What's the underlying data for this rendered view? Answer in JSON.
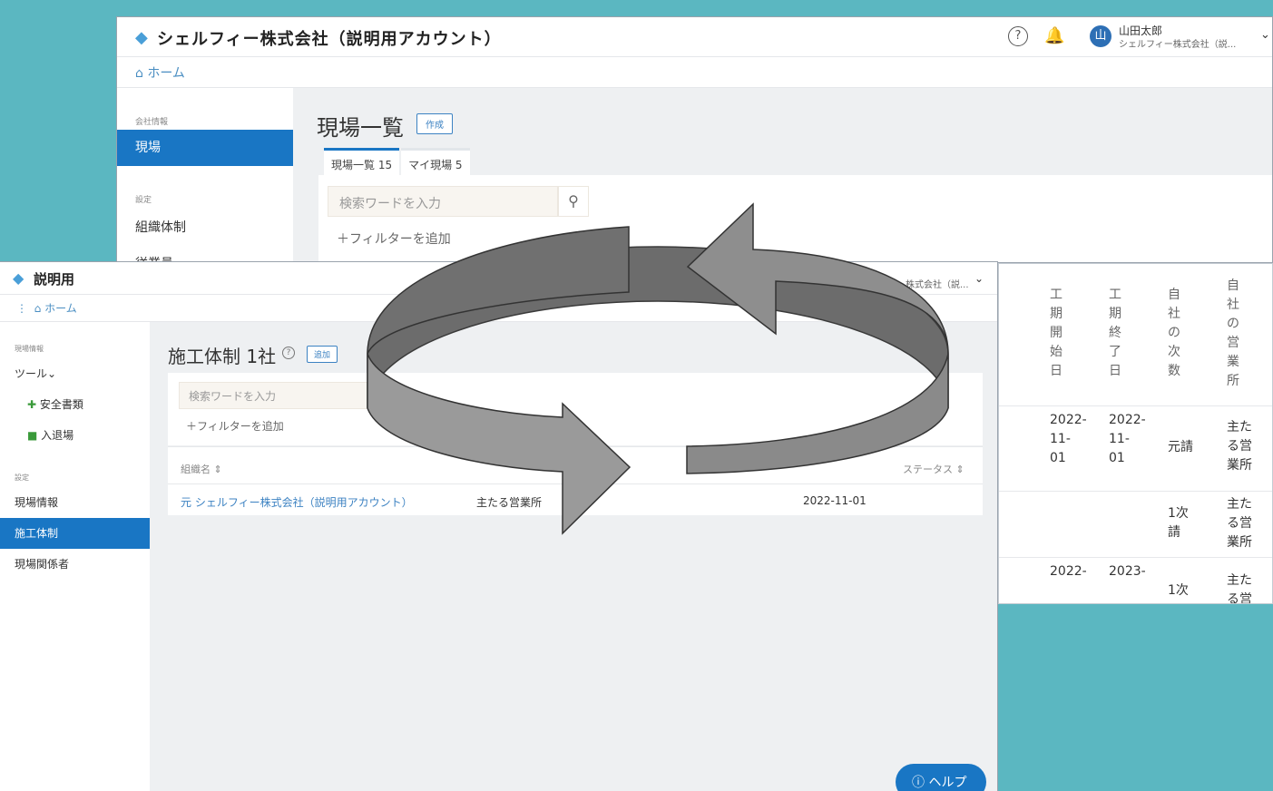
{
  "back_window": {
    "company_name": "シェルフィー株式会社（説明用アカウント）",
    "user": {
      "avatar": "山",
      "name": "山田太郎",
      "company": "シェルフィー株式会社（説..."
    },
    "breadcrumb": "ホーム",
    "sidebar": {
      "section_company": "会社情報",
      "item_sites": "現場",
      "section_settings": "設定",
      "item_org": "組織体制",
      "item_employees": "従業員"
    },
    "page_title": "現場一覧",
    "create_button": "作成",
    "tabs": [
      {
        "label": "現場一覧 15"
      },
      {
        "label": "マイ現場 5"
      }
    ],
    "search_placeholder": "検索ワードを入力",
    "filter_label": "＋フィルターを追加",
    "table_fragment": {
      "headers": [
        "工期開始日",
        "工期終了日",
        "自社の次数",
        "自社の営業所"
      ],
      "rows": [
        {
          "start": "2022-11-01",
          "end": "2022-11-01",
          "tier": "元請",
          "office": "主たる営業所"
        },
        {
          "start": "",
          "end": "",
          "tier": "1次請",
          "office": "主たる営業所"
        },
        {
          "start": "2022-",
          "end": "2023-",
          "tier": "1次",
          "office": "主たる営"
        }
      ]
    }
  },
  "front_window": {
    "company_name": "説明用",
    "user_company": "株式会社（説...",
    "breadcrumb": "ホーム",
    "sidebar": {
      "section_site": "現場情報",
      "tools_label": "ツール",
      "tool_safety": "安全書類",
      "tool_entry": "入退場",
      "section_settings": "設定",
      "item_site_info": "現場情報",
      "item_structure": "施工体制",
      "item_people": "現場関係者"
    },
    "page_title": "施工体制 1社",
    "add_button": "追加",
    "search_placeholder": "検索ワードを入力",
    "filter_label": "＋フィルターを追加",
    "table": {
      "headers": [
        "組織名",
        "",
        "",
        "ステータス"
      ],
      "row": {
        "tier": "元",
        "org": "シェルフィー株式会社（説明用アカウント）",
        "office": "主たる営業所",
        "date": "2022-11-01"
      }
    },
    "help_button": "ヘルプ"
  },
  "colors": {
    "background": "#5bb7c1",
    "primary": "#1976c4",
    "arrow": "#8c8c8c"
  }
}
